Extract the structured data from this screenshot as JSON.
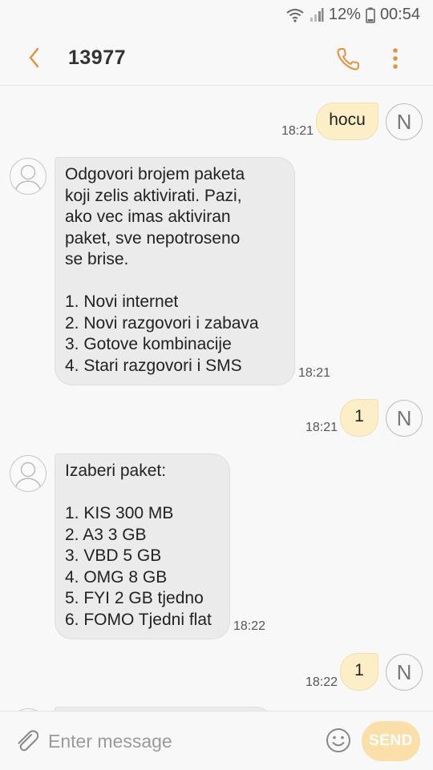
{
  "status": {
    "battery": "12%",
    "time": "00:54"
  },
  "header": {
    "title": "13977"
  },
  "messages": [
    {
      "direction": "outgoing",
      "text": "hocu",
      "time": "18:21",
      "avatar_letter": "N"
    },
    {
      "direction": "incoming",
      "text": "Odgovori brojem paketa\nkoji zelis aktivirati. Pazi,\nako vec imas aktiviran\npaket, sve nepotroseno\nse brise.\n\n1. Novi internet\n2. Novi razgovori i zabava\n3. Gotove kombinacije\n4. Stari razgovori i SMS",
      "time": "18:21"
    },
    {
      "direction": "outgoing",
      "text": "1",
      "time": "18:21",
      "avatar_letter": "N"
    },
    {
      "direction": "incoming",
      "text": "Izaberi paket:\n\n1. KIS 300 MB\n2. A3 3 GB\n3. VBD 5 GB\n4. OMG 8 GB\n5. FYI 2 GB tjedno\n6. FOMO Tjedni flat",
      "time": "18:22"
    },
    {
      "direction": "outgoing",
      "text": "1",
      "time": "18:22",
      "avatar_letter": "N"
    }
  ],
  "composer": {
    "placeholder": "Enter message",
    "send_label": "SEND"
  },
  "colors": {
    "accent": "#e8913a",
    "outgoing_bubble": "#fcefc7",
    "incoming_bubble": "#ebebeb",
    "send_button": "#fae0a8"
  }
}
